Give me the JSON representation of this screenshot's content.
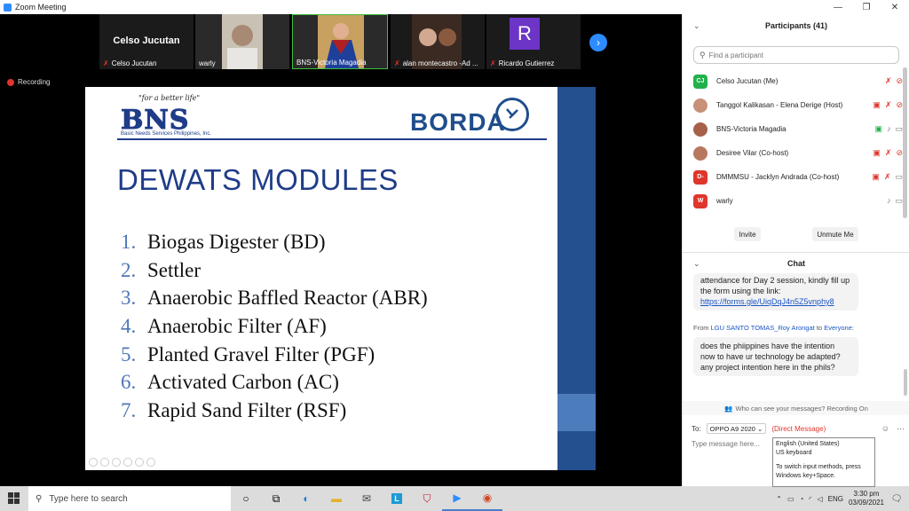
{
  "window": {
    "title": "Zoom Meeting",
    "minimize": "—",
    "maximize": "❐",
    "close": "✕"
  },
  "video_strip": {
    "tiles": [
      {
        "name": "Celso Jucutan",
        "big_name": "Celso Jucutan"
      },
      {
        "name": "warly"
      },
      {
        "name": "BNS-Victoria Magadia"
      },
      {
        "name": "alan montecastro -Ad ..."
      },
      {
        "name": "Ricardo Gutierrez",
        "avatar_letter": "R"
      }
    ],
    "next_arrow": "›"
  },
  "recording": {
    "label": "Recording"
  },
  "slide": {
    "tagline": "\"for a better life\"",
    "bns_logo": "BNS",
    "bns_sub": "Basic Needs Services Philippines, Inc.",
    "borda_logo": "BORDA",
    "title": "DEWATS MODULES",
    "modules": [
      {
        "num": "1.",
        "text": "Biogas Digester (BD)"
      },
      {
        "num": "2.",
        "text": "Settler"
      },
      {
        "num": "3.",
        "text": "Anaerobic Baffled Reactor (ABR)"
      },
      {
        "num": "4.",
        "text": "Anaerobic Filter (AF)"
      },
      {
        "num": "5.",
        "text": "Planted Gravel Filter (PGF)"
      },
      {
        "num": "6.",
        "text": "Activated Carbon (AC)"
      },
      {
        "num": "7.",
        "text": "Rapid Sand Filter (RSF)"
      }
    ]
  },
  "participants": {
    "title": "Participants (41)",
    "search_placeholder": "Find a participant",
    "list": [
      {
        "initials": "CJ",
        "color": "#22b14c",
        "name": "Celso Jucutan (Me)",
        "icons": [
          "mic-off",
          "video-off"
        ]
      },
      {
        "initials": "",
        "color": "#c89078",
        "name": "Tanggol Kalikasan - Elena Derige (Host)",
        "icons": [
          "share",
          "mic-off",
          "video-off"
        ]
      },
      {
        "initials": "",
        "color": "#a8604a",
        "name": "BNS-Victoria Magadia",
        "icons": [
          "share-green",
          "mic",
          "video"
        ]
      },
      {
        "initials": "",
        "color": "#b87860",
        "name": "Desiree Vilar (Co-host)",
        "icons": [
          "share",
          "mic-off",
          "video-off"
        ]
      },
      {
        "initials": "D-",
        "color": "#e0352b",
        "name": "DMMMSU - Jacklyn Andrada (Co-host)",
        "icons": [
          "share",
          "mic-off",
          "video"
        ]
      },
      {
        "initials": "W",
        "color": "#e0352b",
        "name": "warly",
        "icons": [
          "mic",
          "video"
        ]
      }
    ],
    "invite": "Invite",
    "unmute_me": "Unmute Me"
  },
  "chat": {
    "title": "Chat",
    "message1_text": "attendance for Day 2 session, kindly fill up the form using the link:",
    "message1_link": "https://forms.gle/UiqDqJ4n5Z5vnphy8",
    "from_prefix": "From",
    "from_sender": "LGU SANTO TOMAS_Roy Arongat",
    "from_to": "to",
    "from_recipient": "Everyone",
    "from_suffix": ":",
    "message2_text": "does the phiippines have the intention now to have ur technology be adapted? any project intention here in the phils?",
    "who_can_see": "Who can see your messages? Recording On",
    "to_label": "To:",
    "to_value": "OPPO A9 2020",
    "direct_message": "(Direct Message)",
    "compose_placeholder": "Type message here..."
  },
  "ime_tooltip": {
    "line1": "English (United States)",
    "line2": "US keyboard",
    "line3": "To switch input methods, press Windows key+Space."
  },
  "taskbar": {
    "search_placeholder": "Type here to search",
    "language": "ENG",
    "time": "3:30 pm",
    "date": "03/09/2021"
  }
}
